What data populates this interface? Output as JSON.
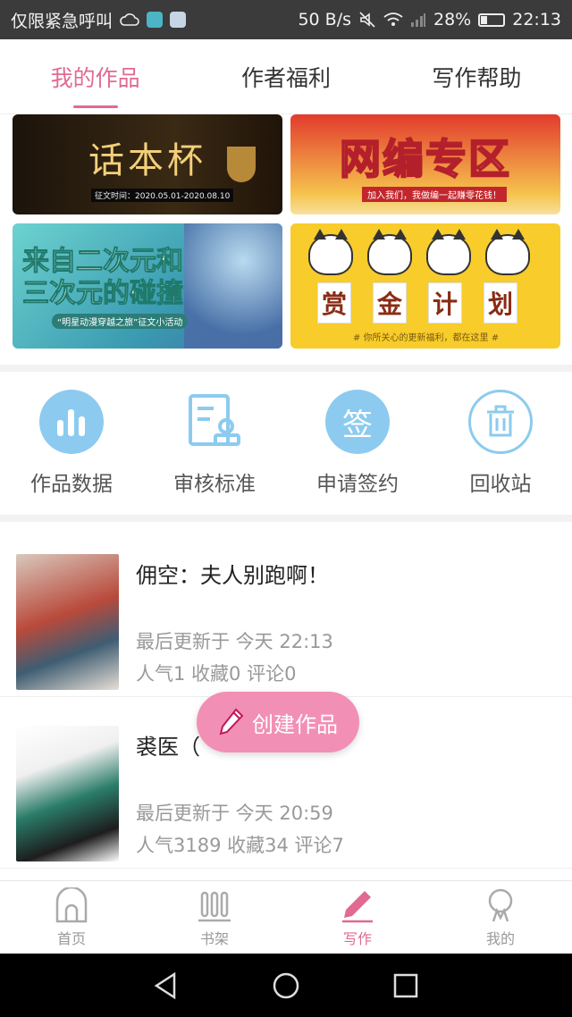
{
  "status_bar": {
    "carrier": "仅限紧急呼叫",
    "net_speed": "50 B/s",
    "battery": "28%",
    "battery_level": 0.28,
    "time": "22:13"
  },
  "tabs": [
    {
      "label": "我的作品",
      "active": true
    },
    {
      "label": "作者福利",
      "active": false
    },
    {
      "label": "写作帮助",
      "active": false
    }
  ],
  "banners": [
    {
      "title": "话本杯",
      "subtitle": "征文时间：2020.05.01-2020.08.10"
    },
    {
      "title": "网编专区",
      "subtitle": "加入我们，我做编一起赚零花钱！"
    },
    {
      "title": "来自二次元和三次元的碰撞",
      "subtitle": "“明星动漫穿越之旅”征文小活动"
    },
    {
      "title": "赏金计划",
      "chars": [
        "赏",
        "金",
        "计",
        "划"
      ],
      "subtitle": "# 你所关心的更新福利，都在这里 #"
    }
  ],
  "tools": [
    {
      "label": "作品数据",
      "icon": "bar-chart-icon"
    },
    {
      "label": "审核标准",
      "icon": "document-stamp-icon"
    },
    {
      "label": "申请签约",
      "icon": "sign-icon",
      "glyph": "签"
    },
    {
      "label": "回收站",
      "icon": "trash-icon"
    }
  ],
  "works": [
    {
      "title": "佣空：夫人别跑啊！",
      "updated": "最后更新于 今天 22:13",
      "stats": "人气1 收藏0 评论0"
    },
    {
      "title": "裘医（",
      "updated": "最后更新于 今天 20:59",
      "stats": "人气3189 收藏34 评论7"
    }
  ],
  "fab": {
    "label": "创建作品",
    "icon": "pencil-icon"
  },
  "bottom_nav": [
    {
      "label": "首页",
      "icon": "home-icon",
      "active": false
    },
    {
      "label": "书架",
      "icon": "bookshelf-icon",
      "active": false
    },
    {
      "label": "写作",
      "icon": "pen-icon",
      "active": true
    },
    {
      "label": "我的",
      "icon": "profile-icon",
      "active": false
    }
  ],
  "colors": {
    "accent": "#e06a92",
    "fab": "#f28fb4",
    "icon_blue": "#8ccbef"
  }
}
